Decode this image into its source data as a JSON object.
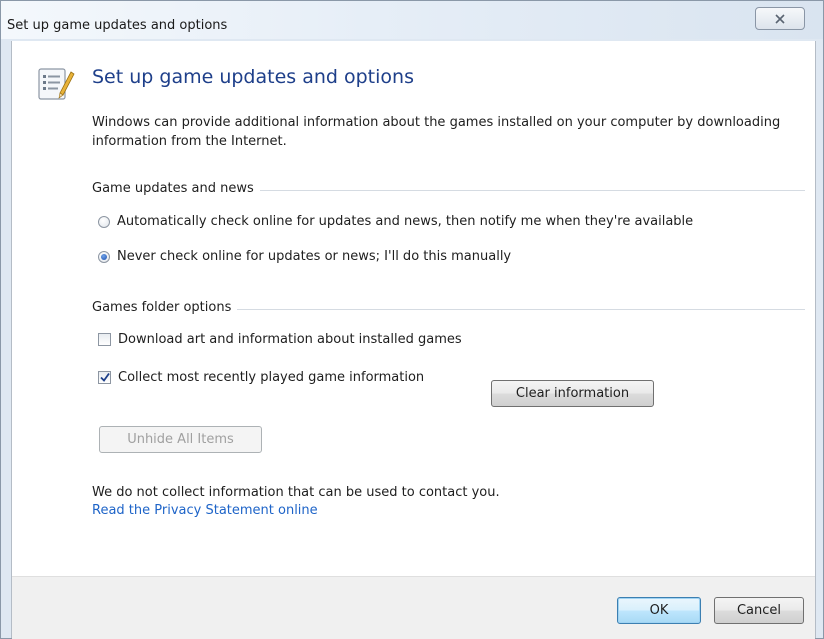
{
  "window": {
    "title": "Set up game updates and options"
  },
  "header": {
    "title": "Set up game updates and options",
    "description": "Windows can provide additional information about the games installed on your computer by downloading information from the Internet."
  },
  "game_updates": {
    "group_label": "Game updates and news",
    "options": [
      {
        "label": "Automatically check online for updates and news, then notify me when they're available",
        "selected": false
      },
      {
        "label": "Never check online for updates or news; I'll do this manually",
        "selected": true
      }
    ]
  },
  "games_folder": {
    "group_label": "Games folder options",
    "download_art": {
      "label": "Download art and information about installed games",
      "checked": false
    },
    "collect_recent": {
      "label": "Collect most recently played game information",
      "checked": true
    },
    "clear_button": "Clear information",
    "unhide_button": "Unhide All Items"
  },
  "privacy": {
    "text": "We do not collect information that can be used to contact you.",
    "link": "Read the Privacy Statement online"
  },
  "footer": {
    "ok_label": "OK",
    "cancel_label": "Cancel"
  },
  "icons": {
    "close": "close-icon",
    "header": "settings-list-icon"
  },
  "colors": {
    "title_blue": "#1e3f8a",
    "link_blue": "#1e64c8",
    "default_button_border": "#3c7fb1"
  }
}
